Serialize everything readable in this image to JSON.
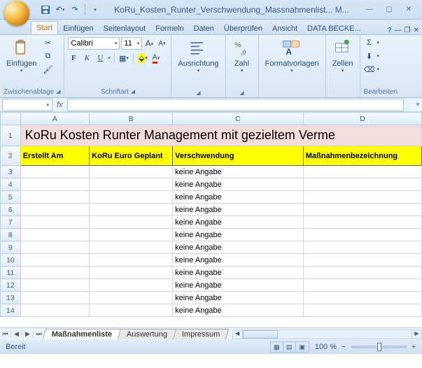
{
  "title": "KoRu_Kosten_Runter_Verschwendung_Massnahmenlist... M...",
  "ribbon_tabs": [
    "Start",
    "Einfügen",
    "Seitenlayout",
    "Formeln",
    "Daten",
    "Überprüfen",
    "Ansicht",
    "DATA BECKE..."
  ],
  "active_tab": "Start",
  "groups": {
    "clipboard": {
      "label": "Zwischenablage",
      "paste": "Einfügen"
    },
    "font": {
      "label": "Schriftart",
      "name": "Calibri",
      "size": "11"
    },
    "alignment": {
      "label": "Ausrichtung"
    },
    "number": {
      "label": "Zahl"
    },
    "styles": {
      "label": "Formatvorlagen"
    },
    "cells": {
      "label": "Zellen"
    },
    "editing": {
      "label": "Bearbeiten"
    }
  },
  "namebox": "",
  "columns": [
    "",
    "A",
    "B",
    "C",
    "D"
  ],
  "title_row": "KoRu Kosten Runter Management mit gezieltem Verme",
  "headers": [
    "Erstellt Am",
    "KoRu Euro Geplant",
    "Verschwendung",
    "Maßnahmenbezeichnung"
  ],
  "rows": [
    {
      "n": 3,
      "a": "",
      "b": "",
      "c": "keine Angabe",
      "d": ""
    },
    {
      "n": 4,
      "a": "",
      "b": "",
      "c": "keine Angabe",
      "d": ""
    },
    {
      "n": 5,
      "a": "",
      "b": "",
      "c": "keine Angabe",
      "d": ""
    },
    {
      "n": 6,
      "a": "",
      "b": "",
      "c": "keine Angabe",
      "d": ""
    },
    {
      "n": 7,
      "a": "",
      "b": "",
      "c": "keine Angabe",
      "d": ""
    },
    {
      "n": 8,
      "a": "",
      "b": "",
      "c": "keine Angabe",
      "d": ""
    },
    {
      "n": 9,
      "a": "",
      "b": "",
      "c": "keine Angabe",
      "d": ""
    },
    {
      "n": 10,
      "a": "",
      "b": "",
      "c": "keine Angabe",
      "d": ""
    },
    {
      "n": 11,
      "a": "",
      "b": "",
      "c": "keine Angabe",
      "d": ""
    },
    {
      "n": 12,
      "a": "",
      "b": "",
      "c": "keine Angabe",
      "d": ""
    },
    {
      "n": 13,
      "a": "",
      "b": "",
      "c": "keine Angabe",
      "d": ""
    },
    {
      "n": 14,
      "a": "",
      "b": "",
      "c": "keine Angabe",
      "d": ""
    }
  ],
  "sheet_tabs": [
    "Maßnahmenliste",
    "Auswertung",
    "Impressum"
  ],
  "active_sheet": "Maßnahmenliste",
  "status": "Bereit",
  "zoom": "100 %"
}
